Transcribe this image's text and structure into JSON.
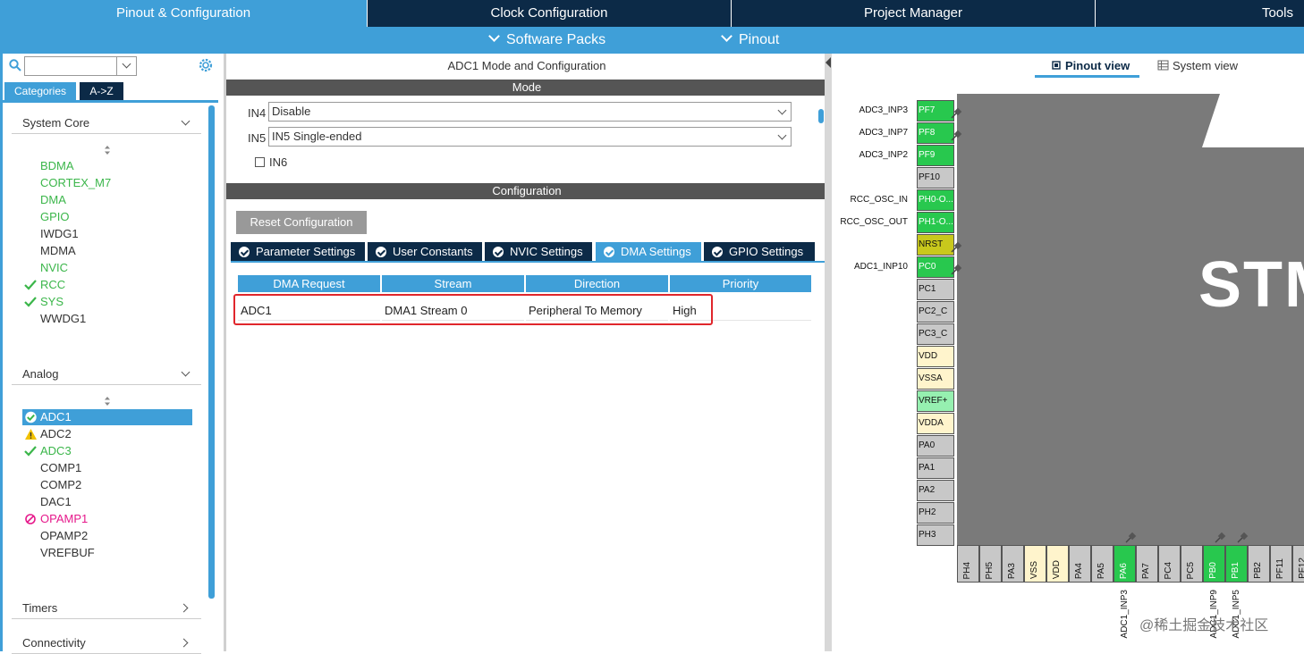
{
  "top_tabs": [
    "Pinout & Configuration",
    "Clock Configuration",
    "Project Manager",
    "Tools"
  ],
  "sub_menu": [
    "Software Packs",
    "Pinout"
  ],
  "left": {
    "category_tabs": [
      "Categories",
      "A->Z"
    ],
    "groups": {
      "system_core": {
        "title": "System Core",
        "items": [
          "BDMA",
          "CORTEX_M7",
          "DMA",
          "GPIO",
          "IWDG1",
          "MDMA",
          "NVIC",
          "RCC",
          "SYS",
          "WWDG1"
        ]
      },
      "analog": {
        "title": "Analog",
        "items": [
          "ADC1",
          "ADC2",
          "ADC3",
          "COMP1",
          "COMP2",
          "DAC1",
          "OPAMP1",
          "OPAMP2",
          "VREFBUF"
        ]
      },
      "timers": {
        "title": "Timers"
      },
      "connectivity": {
        "title": "Connectivity"
      }
    }
  },
  "mid": {
    "title": "ADC1 Mode and Configuration",
    "mode_header": "Mode",
    "mode_rows": [
      {
        "label": "IN4",
        "value": "Disable"
      },
      {
        "label": "IN5",
        "value": "IN5 Single-ended"
      }
    ],
    "in6_label": "IN6",
    "config_header": "Configuration",
    "reset_button": "Reset Configuration",
    "settings_tabs": [
      "Parameter Settings",
      "User Constants",
      "NVIC Settings",
      "DMA Settings",
      "GPIO Settings"
    ],
    "dma_table": {
      "headers": [
        "DMA Request",
        "Stream",
        "Direction",
        "Priority"
      ],
      "rows": [
        [
          "ADC1",
          "DMA1 Stream 0",
          "Peripheral To Memory",
          "High"
        ]
      ]
    }
  },
  "right": {
    "view_tabs": [
      "Pinout view",
      "System view"
    ],
    "chip_text": "STM",
    "left_pins": [
      {
        "name": "PF7",
        "label": "ADC3_INP3"
      },
      {
        "name": "PF8",
        "label": "ADC3_INP7"
      },
      {
        "name": "PF9",
        "label": "ADC3_INP2"
      },
      {
        "name": "PF10",
        "label": ""
      },
      {
        "name": "PH0-O...",
        "label": "RCC_OSC_IN"
      },
      {
        "name": "PH1-O...",
        "label": "RCC_OSC_OUT"
      },
      {
        "name": "NRST",
        "label": ""
      },
      {
        "name": "PC0",
        "label": "ADC1_INP10"
      },
      {
        "name": "PC1",
        "label": ""
      },
      {
        "name": "PC2_C",
        "label": ""
      },
      {
        "name": "PC3_C",
        "label": ""
      },
      {
        "name": "VDD",
        "label": ""
      },
      {
        "name": "VSSA",
        "label": ""
      },
      {
        "name": "VREF+",
        "label": ""
      },
      {
        "name": "VDDA",
        "label": ""
      },
      {
        "name": "PA0",
        "label": ""
      },
      {
        "name": "PA1",
        "label": ""
      },
      {
        "name": "PA2",
        "label": ""
      },
      {
        "name": "PH2",
        "label": ""
      },
      {
        "name": "PH3",
        "label": ""
      }
    ],
    "bottom_pins": [
      "PH4",
      "PH5",
      "PA3",
      "VSS",
      "VDD",
      "PA4",
      "PA5",
      "PA6",
      "PA7",
      "PC4",
      "PC5",
      "PB0",
      "PB1",
      "PB2",
      "PF11",
      "PF12"
    ],
    "bottom_labels": [
      "ADC1_INP3",
      "ADC1_INP9",
      "ADC1_INP5"
    ],
    "watermark": "@稀土掘金技术社区"
  },
  "colors": {
    "accent": "#3f9fd8",
    "dark_tab": "#0c2a47",
    "green_pin": "#28c84e",
    "highlight": "#e0262c"
  }
}
